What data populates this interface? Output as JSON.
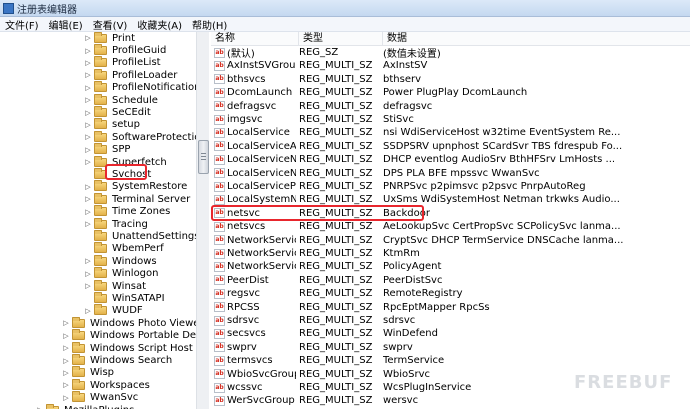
{
  "window": {
    "title": "注册表编辑器"
  },
  "menu": [
    "文件(F)",
    "编辑(E)",
    "查看(V)",
    "收藏夹(A)",
    "帮助(H)"
  ],
  "tree": {
    "items": [
      {
        "label": "Print",
        "expandable": true,
        "level": 2
      },
      {
        "label": "ProfileGuid",
        "expandable": true,
        "level": 2
      },
      {
        "label": "ProfileList",
        "expandable": true,
        "level": 2
      },
      {
        "label": "ProfileLoader",
        "expandable": true,
        "level": 2
      },
      {
        "label": "ProfileNotification",
        "expandable": true,
        "level": 2
      },
      {
        "label": "Schedule",
        "expandable": true,
        "level": 2
      },
      {
        "label": "SeCEdit",
        "expandable": true,
        "level": 2
      },
      {
        "label": "setup",
        "expandable": true,
        "level": 2
      },
      {
        "label": "SoftwareProtectionPla",
        "expandable": true,
        "level": 2
      },
      {
        "label": "SPP",
        "expandable": true,
        "level": 2
      },
      {
        "label": "Superfetch",
        "expandable": true,
        "level": 2
      },
      {
        "label": "Svchost",
        "expandable": false,
        "level": 2,
        "selected": true
      },
      {
        "label": "SystemRestore",
        "expandable": true,
        "level": 2
      },
      {
        "label": "Terminal Server",
        "expandable": true,
        "level": 2
      },
      {
        "label": "Time Zones",
        "expandable": true,
        "level": 2
      },
      {
        "label": "Tracing",
        "expandable": true,
        "level": 2
      },
      {
        "label": "UnattendSettings",
        "expandable": false,
        "level": 2
      },
      {
        "label": "WbemPerf",
        "expandable": false,
        "level": 2
      },
      {
        "label": "Windows",
        "expandable": true,
        "level": 2
      },
      {
        "label": "Winlogon",
        "expandable": true,
        "level": 2
      },
      {
        "label": "Winsat",
        "expandable": true,
        "level": 2
      },
      {
        "label": "WinSATAPI",
        "expandable": false,
        "level": 2
      },
      {
        "label": "WUDF",
        "expandable": true,
        "level": 2
      },
      {
        "label": "Windows Photo Viewer",
        "expandable": true,
        "level": 1
      },
      {
        "label": "Windows Portable Devices",
        "expandable": true,
        "level": 1
      },
      {
        "label": "Windows Script Host",
        "expandable": true,
        "level": 1
      },
      {
        "label": "Windows Search",
        "expandable": true,
        "level": 1
      },
      {
        "label": "Wisp",
        "expandable": true,
        "level": 1
      },
      {
        "label": "Workspaces",
        "expandable": true,
        "level": 1
      },
      {
        "label": "WwanSvc",
        "expandable": true,
        "level": 1
      },
      {
        "label": "MozillaPlugins",
        "expandable": true,
        "level": 0
      }
    ]
  },
  "columns": {
    "name": "名称",
    "type": "类型",
    "data": "数据"
  },
  "values": [
    {
      "name": "(默认)",
      "type": "REG_SZ",
      "data": "(数值未设置)"
    },
    {
      "name": "AxInstSVGroup",
      "type": "REG_MULTI_SZ",
      "data": "AxInstSV"
    },
    {
      "name": "bthsvcs",
      "type": "REG_MULTI_SZ",
      "data": "bthserv"
    },
    {
      "name": "DcomLaunch",
      "type": "REG_MULTI_SZ",
      "data": "Power PlugPlay DcomLaunch"
    },
    {
      "name": "defragsvc",
      "type": "REG_MULTI_SZ",
      "data": "defragsvc"
    },
    {
      "name": "imgsvc",
      "type": "REG_MULTI_SZ",
      "data": "StiSvc"
    },
    {
      "name": "LocalService",
      "type": "REG_MULTI_SZ",
      "data": "nsi WdiServiceHost w32time EventSystem Re..."
    },
    {
      "name": "LocalServiceA...",
      "type": "REG_MULTI_SZ",
      "data": "SSDPSRV upnphost SCardSvr TBS fdrespub Fo..."
    },
    {
      "name": "LocalServiceN...",
      "type": "REG_MULTI_SZ",
      "data": "DHCP eventlog AudioSrv BthHFSrv LmHosts ..."
    },
    {
      "name": "LocalServiceN...",
      "type": "REG_MULTI_SZ",
      "data": "DPS PLA BFE mpssvc WwanSvc"
    },
    {
      "name": "LocalServicePe...",
      "type": "REG_MULTI_SZ",
      "data": "PNRPSvc p2pimsvc p2psvc PnrpAutoReg"
    },
    {
      "name": "LocalSystemN...",
      "type": "REG_MULTI_SZ",
      "data": "UxSms WdiSystemHost Netman trkwks Audio..."
    },
    {
      "name": "netsvc",
      "type": "REG_MULTI_SZ",
      "data": "Backdoor"
    },
    {
      "name": "netsvcs",
      "type": "REG_MULTI_SZ",
      "data": "AeLookupSvc CertPropSvc SCPolicySvc lanma..."
    },
    {
      "name": "NetworkService",
      "type": "REG_MULTI_SZ",
      "data": "CryptSvc DHCP TermService DNSCache lanma..."
    },
    {
      "name": "NetworkServic...",
      "type": "REG_MULTI_SZ",
      "data": "KtmRm"
    },
    {
      "name": "NetworkServic...",
      "type": "REG_MULTI_SZ",
      "data": "PolicyAgent"
    },
    {
      "name": "PeerDist",
      "type": "REG_MULTI_SZ",
      "data": "PeerDistSvc"
    },
    {
      "name": "regsvc",
      "type": "REG_MULTI_SZ",
      "data": "RemoteRegistry"
    },
    {
      "name": "RPCSS",
      "type": "REG_MULTI_SZ",
      "data": "RpcEptMapper RpcSs"
    },
    {
      "name": "sdrsvc",
      "type": "REG_MULTI_SZ",
      "data": "sdrsvc"
    },
    {
      "name": "secsvcs",
      "type": "REG_MULTI_SZ",
      "data": "WinDefend"
    },
    {
      "name": "swprv",
      "type": "REG_MULTI_SZ",
      "data": "swprv"
    },
    {
      "name": "termsvcs",
      "type": "REG_MULTI_SZ",
      "data": "TermService"
    },
    {
      "name": "WbioSvcGroup",
      "type": "REG_MULTI_SZ",
      "data": "WbioSrvc"
    },
    {
      "name": "wcssvc",
      "type": "REG_MULTI_SZ",
      "data": "WcsPlugInService"
    },
    {
      "name": "WerSvcGroup",
      "type": "REG_MULTI_SZ",
      "data": "wersvc"
    }
  ],
  "value_icon": "ab",
  "watermark": "FREEBUF",
  "colors": {
    "highlight": "#e8262d",
    "value_icon": "#d42b1e"
  }
}
